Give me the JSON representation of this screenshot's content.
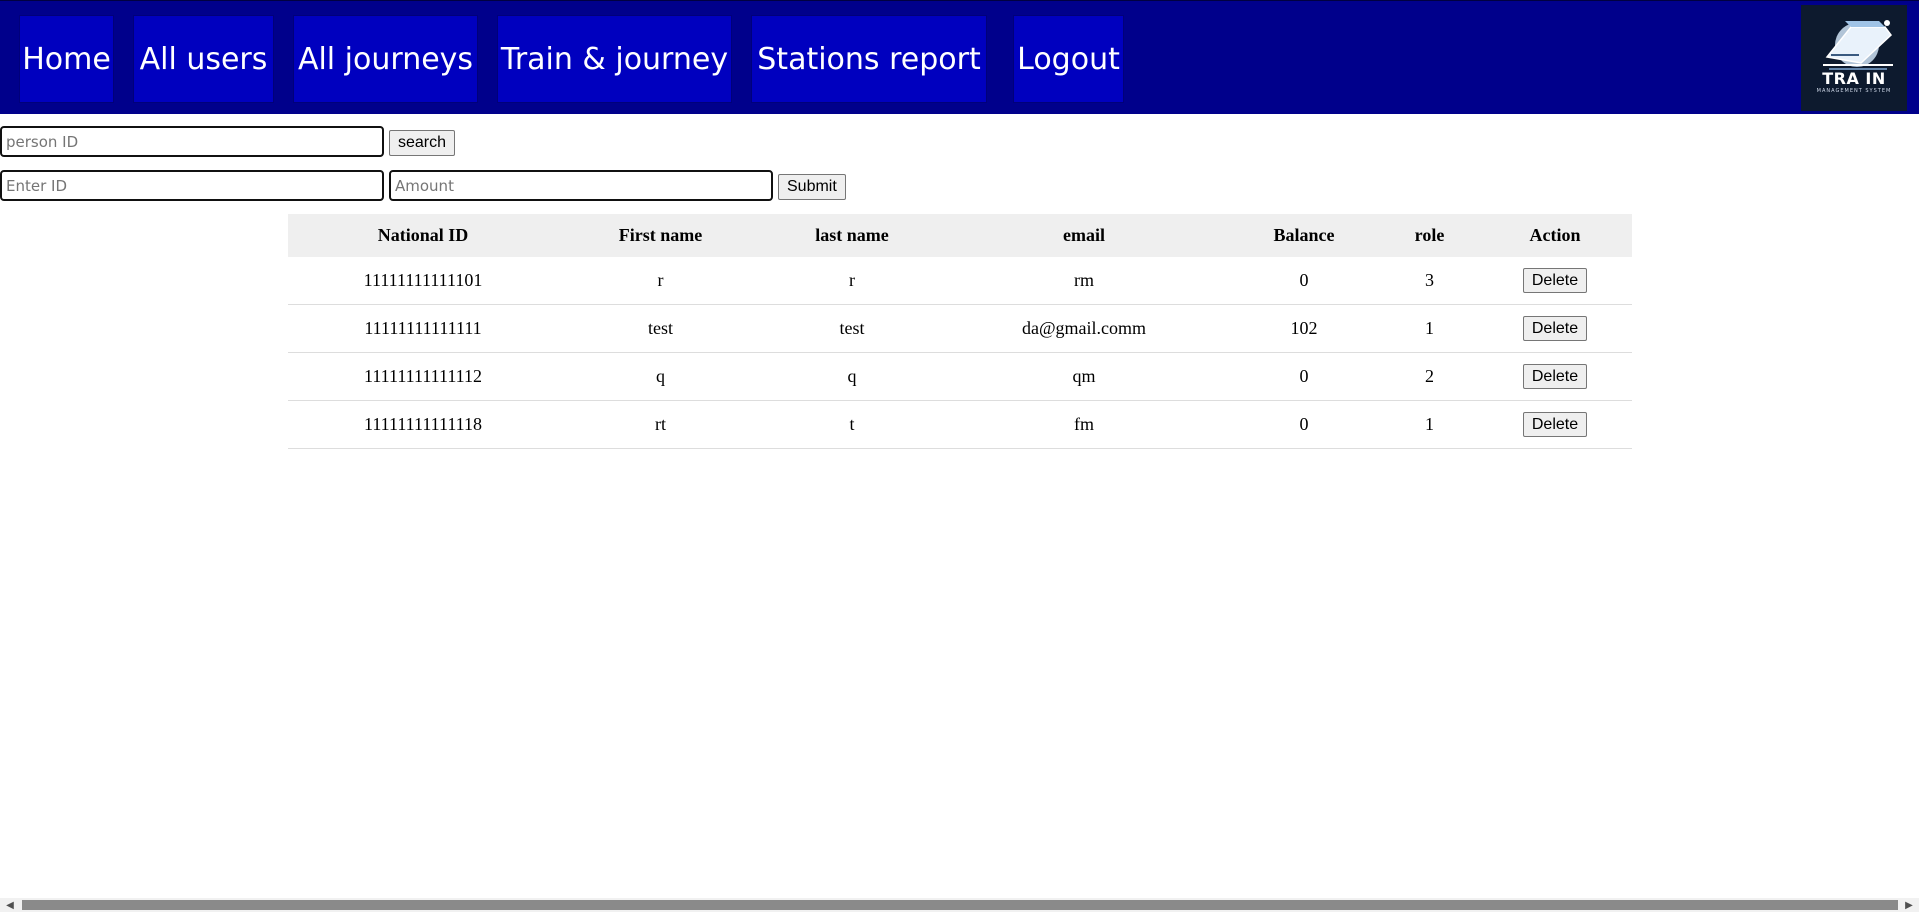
{
  "nav": {
    "items": [
      {
        "label": "Home"
      },
      {
        "label": "All users"
      },
      {
        "label": "All journeys"
      },
      {
        "label": "Train & journey"
      },
      {
        "label": "Stations report"
      },
      {
        "label": "Logout"
      }
    ],
    "logo_text": "TRA IN",
    "logo_subtext": "MANAGEMENT SYSTEM"
  },
  "search": {
    "placeholder": "person ID",
    "button_label": "search"
  },
  "balance_form": {
    "id_placeholder": "Enter ID",
    "amount_placeholder": "Amount",
    "submit_label": "Submit"
  },
  "table": {
    "headers": [
      "National ID",
      "First name",
      "last name",
      "email",
      "Balance",
      "role",
      "Action"
    ],
    "rows": [
      {
        "national_id": "11111111111101",
        "first_name": "r",
        "last_name": "r",
        "email": "rm",
        "balance": "0",
        "role": "3",
        "action": "Delete"
      },
      {
        "national_id": "11111111111111",
        "first_name": "test",
        "last_name": "test",
        "email": "da@gmail.comm",
        "balance": "102",
        "role": "1",
        "action": "Delete"
      },
      {
        "national_id": "11111111111112",
        "first_name": "q",
        "last_name": "q",
        "email": "qm",
        "balance": "0",
        "role": "2",
        "action": "Delete"
      },
      {
        "national_id": "11111111111118",
        "first_name": "rt",
        "last_name": "t",
        "email": "fm",
        "balance": "0",
        "role": "1",
        "action": "Delete"
      }
    ]
  },
  "colors": {
    "navbar": "#00008b",
    "nav_button": "#0000bf",
    "header_bg": "#efefef"
  }
}
